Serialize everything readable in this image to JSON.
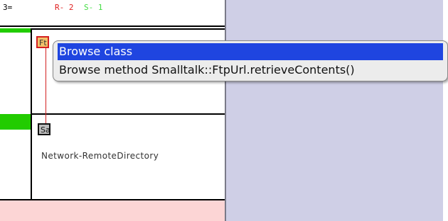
{
  "header": {
    "count": "3=",
    "r_label": "R- 2",
    "s_label": "S- 1"
  },
  "nodes": {
    "ftp_abbrev": "Ft",
    "sa_abbrev": "Sa"
  },
  "category": {
    "label": "Network-RemoteDirectory"
  },
  "context_menu": {
    "items": [
      {
        "label": "Browse class",
        "selected": true
      },
      {
        "label": "Browse method Smalltalk::FtpUrl.retrieveContents()",
        "selected": false
      }
    ]
  },
  "colors": {
    "panel": "#cfcfe6",
    "selection": "#1f45e0",
    "green_bar": "#22cc00",
    "pink_strip": "#fcd5d5",
    "red_accent": "#d42020"
  }
}
